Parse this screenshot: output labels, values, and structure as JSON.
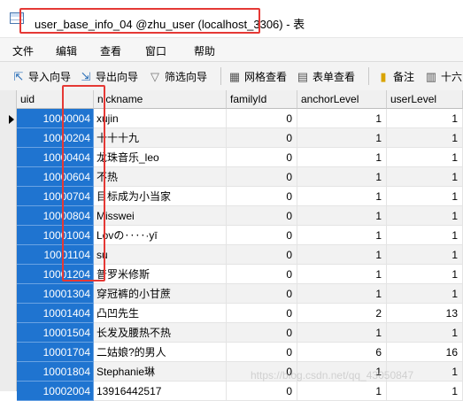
{
  "window": {
    "title": "user_base_info_04 @zhu_user (localhost_3306) - 表"
  },
  "menu": [
    "文件",
    "编辑",
    "查看",
    "窗口",
    "帮助"
  ],
  "toolbar": {
    "import_label": "导入向导",
    "export_label": "导出向导",
    "filter_label": "筛选向导",
    "grid_view_label": "网格查看",
    "form_view_label": "表单查看",
    "memo_label": "备注",
    "hex_label": "十六"
  },
  "table": {
    "columns": [
      "uid",
      "nickname",
      "familyId",
      "anchorLevel",
      "userLevel"
    ],
    "rows": [
      [
        "10000004",
        "xujin",
        "0",
        "1",
        "1"
      ],
      [
        "10000204",
        "十十十九",
        "0",
        "1",
        "1"
      ],
      [
        "10000404",
        "龙珠音乐_leo",
        "0",
        "1",
        "1"
      ],
      [
        "10000604",
        "不热",
        "0",
        "1",
        "1"
      ],
      [
        "10000704",
        "目标成为小当家",
        "0",
        "1",
        "1"
      ],
      [
        "10000804",
        "Misswei",
        "0",
        "1",
        "1"
      ],
      [
        "10001004",
        "Lovの‥‥·yī",
        "0",
        "1",
        "1"
      ],
      [
        "10001104",
        "su",
        "0",
        "1",
        "1"
      ],
      [
        "10001204",
        "普罗米修斯",
        "0",
        "1",
        "1"
      ],
      [
        "10001304",
        "穿冠裤的小甘蔗",
        "0",
        "1",
        "1"
      ],
      [
        "10001404",
        "凸凹先生",
        "0",
        "2",
        "13"
      ],
      [
        "10001504",
        "长发及腰热不热",
        "0",
        "1",
        "1"
      ],
      [
        "10001704",
        "二姑娘?的男人",
        "0",
        "6",
        "16"
      ],
      [
        "10001804",
        "Stephanie琳",
        "0",
        "1",
        "1"
      ],
      [
        "10002004",
        "13916442517",
        "0",
        "1",
        "1"
      ]
    ]
  },
  "watermark": "https://blog.csdn.net/qq_43050847"
}
